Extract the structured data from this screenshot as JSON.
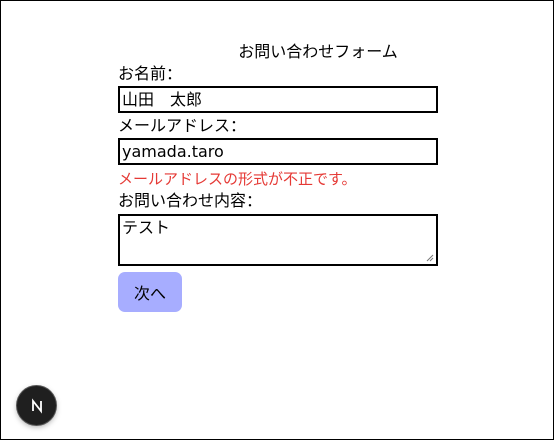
{
  "form": {
    "title": "お問い合わせフォーム",
    "name_label": "お名前：",
    "name_value": "山田　太郎",
    "email_label": "メールアドレス：",
    "email_value": "yamada.taro",
    "email_error": "メールアドレスの形式が不正です。",
    "message_label": "お問い合わせ内容：",
    "message_value": "テスト",
    "next_button_label": "次へ"
  },
  "colors": {
    "error": "#e53935",
    "button_bg": "#a7adff",
    "badge_bg": "#1f1f1f"
  },
  "badge": {
    "icon": "nextjs-logo-icon"
  }
}
